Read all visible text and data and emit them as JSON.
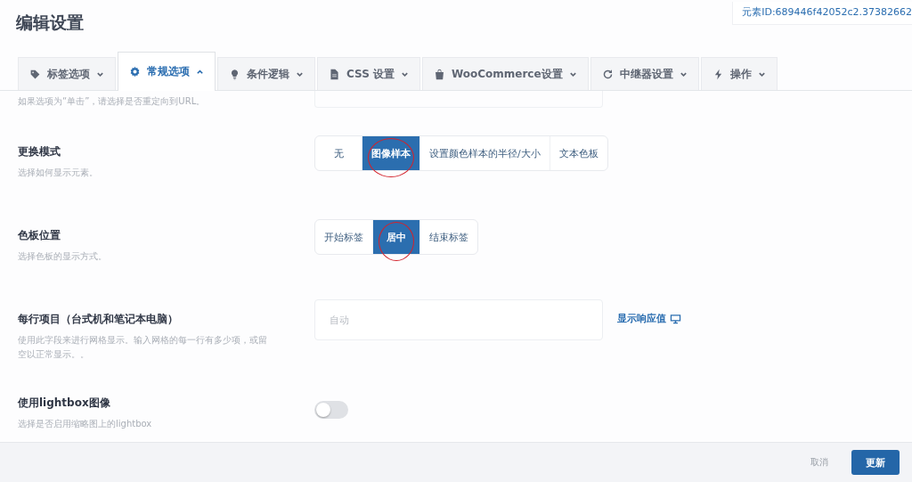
{
  "header": {
    "title": "编辑设置",
    "element_id": "元素ID:689446f42052c2.37382662"
  },
  "tabs": [
    {
      "label": "标签选项",
      "selected": false
    },
    {
      "label": "常规选项",
      "selected": true
    },
    {
      "label": "条件逻辑",
      "selected": false
    },
    {
      "label": "CSS 设置",
      "selected": false
    },
    {
      "label": "WooCommerce设置",
      "selected": false
    },
    {
      "label": "中继器设置",
      "selected": false
    },
    {
      "label": "操作",
      "selected": false
    }
  ],
  "partial_row": {
    "description": "如果选项为“单击”，请选择是否重定向到URL。"
  },
  "settings": [
    {
      "kind": "segmented",
      "label": "更换模式",
      "description": "选择如何显示元素。",
      "options": [
        {
          "label": "无",
          "selected": false,
          "circled": false
        },
        {
          "label": "图像样本",
          "selected": true,
          "circled": true
        },
        {
          "label": "设置颜色样本的半径/大小",
          "selected": false,
          "circled": false
        },
        {
          "label": "文本色板",
          "selected": false,
          "circled": false
        }
      ]
    },
    {
      "kind": "segmented",
      "label": "色板位置",
      "description": "选择色板的显示方式。",
      "options": [
        {
          "label": "开始标签",
          "selected": false,
          "circled": false
        },
        {
          "label": "居中",
          "selected": true,
          "circled": true
        },
        {
          "label": "结束标签",
          "selected": false,
          "circled": false
        }
      ]
    },
    {
      "kind": "text",
      "label": "每行项目（台式机和笔记本电脑）",
      "description": "使用此字段来进行网格显示。输入网格的每一行有多少项，或留空以正常显示。。",
      "placeholder": "自动",
      "link": "显示响应值"
    },
    {
      "kind": "toggle",
      "label": "使用lightbox图像",
      "description": "选择是否启用缩略图上的lightbox",
      "on": false
    }
  ],
  "footer": {
    "cancel": "取消",
    "submit": "更新"
  }
}
